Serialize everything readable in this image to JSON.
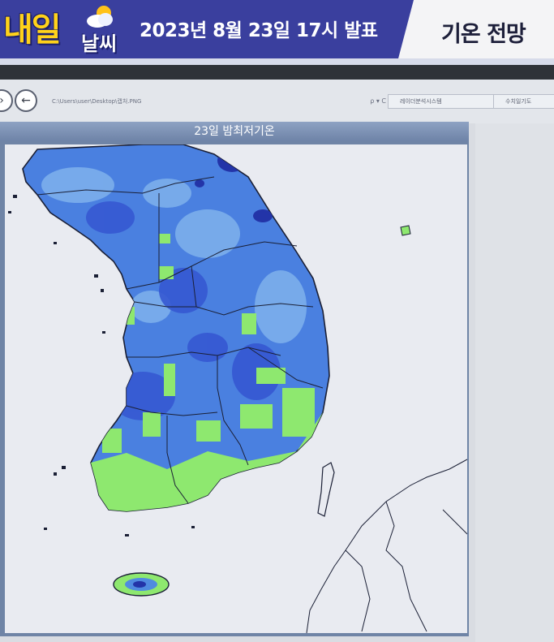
{
  "header": {
    "logo_main": "내일",
    "logo_sub": "날씨",
    "headline": "2023년 8월 23일 17시 발표",
    "section_title": "기온 전망"
  },
  "browser": {
    "address": "C:\\Users\\user\\Desktop\\캡처.PNG",
    "search_glyph": "ρ ▾ C",
    "tabs": [
      "레이더분석시스템",
      "수치일기도"
    ]
  },
  "map": {
    "title": "23일 밤최저기온",
    "colors": {
      "cold": "#3a63d8",
      "cool": "#4f8be0",
      "mild": "#7fb2ec",
      "warm": "#8ee86f",
      "deep": "#2334a8",
      "sea": "#e9ebf1"
    }
  }
}
